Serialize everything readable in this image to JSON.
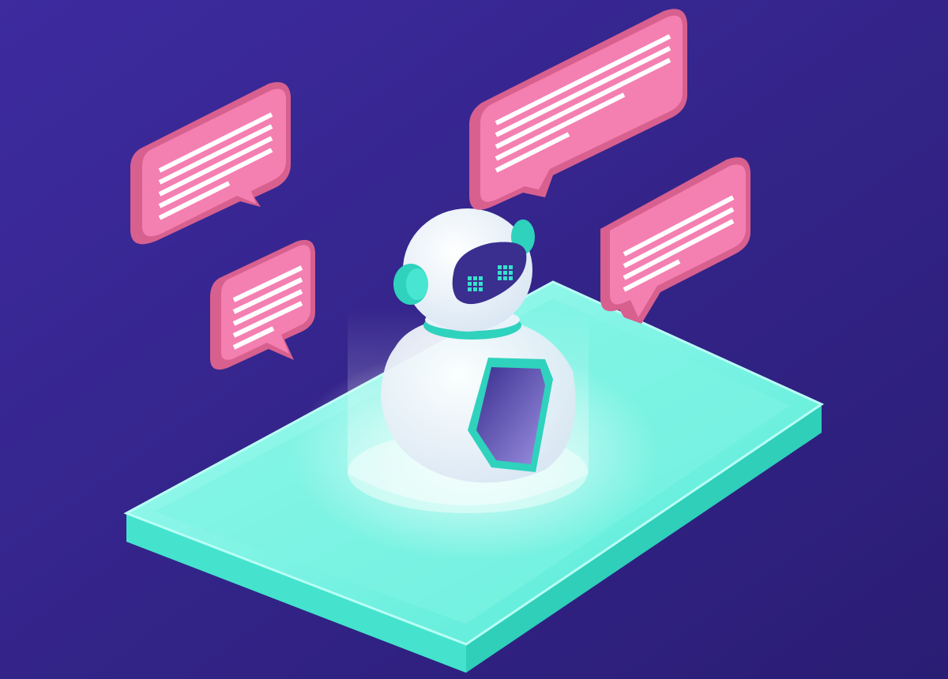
{
  "colors": {
    "background_left": "#3c2a9c",
    "background_right": "#2c1f78",
    "bubble_face": "#f47fb1",
    "bubble_side": "#d8608f",
    "bubble_lines": "#ffffff",
    "phone_top": "#7ff5e6",
    "phone_side": "#38dcc7",
    "robot_body": "#eef4fb",
    "robot_visor": "#3a2e8f",
    "robot_accent": "#2fd2bd"
  },
  "scene": {
    "bubbles": [
      {
        "label": "speech-bubble-upper-left",
        "text_lines": 5
      },
      {
        "label": "speech-bubble-lower-left",
        "text_lines": 5
      },
      {
        "label": "speech-bubble-top-center",
        "text_lines": 6
      },
      {
        "label": "speech-bubble-right",
        "text_lines": 4
      }
    ],
    "robot_eye_grid": "3x3"
  }
}
